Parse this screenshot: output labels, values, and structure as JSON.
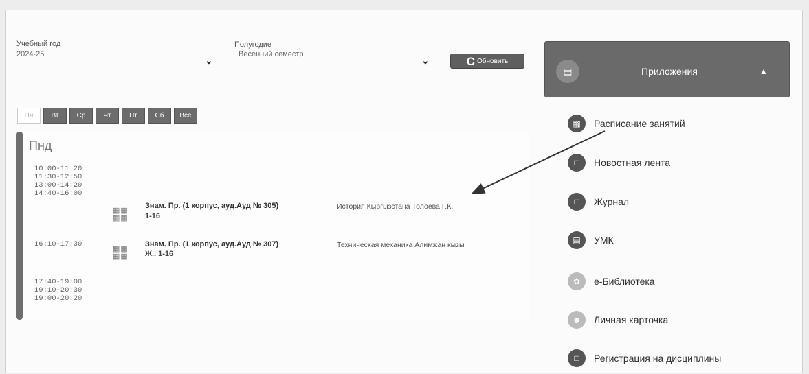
{
  "filters": {
    "year_label": "Учебный год",
    "year_value": "2024-25",
    "half_label": "Полугодие",
    "half_value": "Весенний семестр",
    "refresh_icon": "C",
    "refresh_label": "Обновить"
  },
  "day_tabs": [
    {
      "label": "Пн",
      "active": true
    },
    {
      "label": "Вт"
    },
    {
      "label": "Ср"
    },
    {
      "label": "Чт"
    },
    {
      "label": "Пт"
    },
    {
      "label": "Сб"
    },
    {
      "label": "Все"
    }
  ],
  "schedule": {
    "day": "Пнд",
    "times": [
      "10:00-11:20",
      "11:30-12:50",
      "13:00-14:20",
      "14:40-16:00",
      "16:10-17:30",
      "17:40-19:00",
      "19:10-20:30",
      "19:00-20:20"
    ],
    "lessons": [
      {
        "room": "Знам. Пр. (1 корпус, ауд.Ауд № 305)",
        "subject": "История Кыргызстана Толоева Г.К.",
        "group": "1-16"
      },
      {
        "room": "Знам. Пр. (1 корпус, ауд.Ауд № 307)",
        "subject": "Техническая механика Алимжан кызы",
        "group": "Ж..  1-16"
      }
    ]
  },
  "apps": {
    "title": "Приложения",
    "items": [
      {
        "label": "Расписание занятий",
        "icon": "calendar-icon"
      },
      {
        "label": "Новостная лента",
        "icon": "news-icon"
      },
      {
        "label": "Журнал",
        "icon": "journal-icon"
      },
      {
        "label": "УМК",
        "icon": "book-icon"
      },
      {
        "label": "е-Библиотека",
        "icon": "library-icon"
      },
      {
        "label": "Личная карточка",
        "icon": "person-icon"
      },
      {
        "label": "Регистрация на дисциплины",
        "icon": "registration-icon"
      }
    ]
  }
}
